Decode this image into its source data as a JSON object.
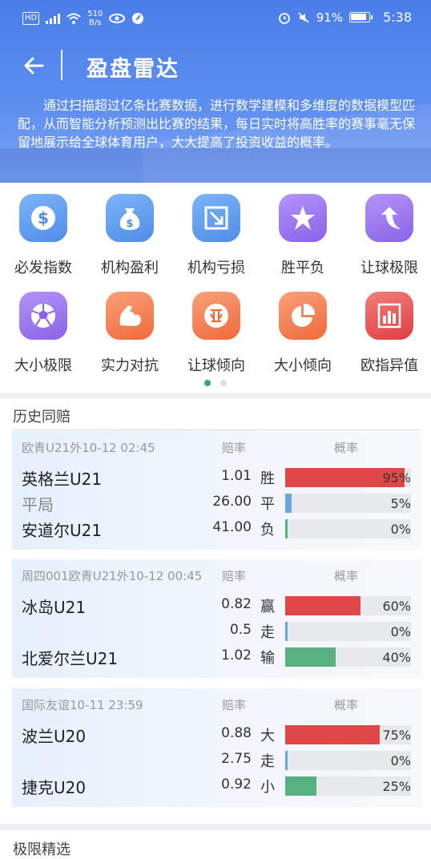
{
  "status": {
    "left_badge": "HD",
    "net_speed_value": "510",
    "net_speed_unit": "B/s",
    "battery": "91%",
    "time": "5:38"
  },
  "header": {
    "title": "盈盘雷达",
    "intro": "通过扫描超过亿条比赛数据，进行数学建模和多维度的数据模型匹配，从而智能分析预测出比赛的结果，每日实时将高胜率的赛事毫无保留地展示给全球体育用户，大大提高了投资收益的概率。"
  },
  "grid": {
    "items": [
      {
        "label": "必发指数",
        "icon": "dollar-coin-icon",
        "color": "#5f9ff3"
      },
      {
        "label": "机构盈利",
        "icon": "money-bag-icon",
        "color": "#5f9ff3"
      },
      {
        "label": "机构亏损",
        "icon": "down-arrow-box-icon",
        "color": "#5f9ff3"
      },
      {
        "label": "胜平负",
        "icon": "star-icon",
        "color": "#9a73ee"
      },
      {
        "label": "让球极限",
        "icon": "curved-arrow-icon",
        "color": "#9a73ee"
      },
      {
        "label": "大小极限",
        "icon": "soccer-ball-icon",
        "color": "#9a73ee"
      },
      {
        "label": "实力对抗",
        "icon": "flexed-arm-icon",
        "color": "#f47a4c"
      },
      {
        "label": "让球倾向",
        "icon": "ya-coin-icon",
        "color": "#f47a4c"
      },
      {
        "label": "大小倾向",
        "icon": "pie-chart-icon",
        "color": "#f47a4c"
      },
      {
        "label": "欧指异值",
        "icon": "bar-chart-icon",
        "color": "#e95050"
      }
    ]
  },
  "history": {
    "title": "历史同赔",
    "odds_header": "赔率",
    "prob_header": "概率",
    "matches": [
      {
        "header": "欧青U21外10-12 02:45",
        "rows": [
          {
            "team": "英格兰U21",
            "odds": "1.01",
            "result": "胜",
            "percent": "95%",
            "fraction": 0.95,
            "color": "#e04848"
          },
          {
            "team": "平局",
            "odds": "26.00",
            "result": "平",
            "percent": "5%",
            "fraction": 0.05,
            "color": "#6aa6e4"
          },
          {
            "team": "安道尔U21",
            "odds": "41.00",
            "result": "负",
            "percent": "0%",
            "fraction": 0.0,
            "color": "#56b07f"
          }
        ]
      },
      {
        "header": "周四001欧青U21外10-12 00:45",
        "rows": [
          {
            "team": "冰岛U21",
            "odds": "0.82",
            "result": "赢",
            "percent": "60%",
            "fraction": 0.6,
            "color": "#e04848"
          },
          {
            "team": "",
            "odds": "0.5",
            "result": "走",
            "percent": "0%",
            "fraction": 0.0,
            "color": "#6aa6e4"
          },
          {
            "team": "北爱尔兰U21",
            "odds": "1.02",
            "result": "输",
            "percent": "40%",
            "fraction": 0.4,
            "color": "#56b07f"
          }
        ]
      },
      {
        "header": "国际友谊10-11 23:59",
        "rows": [
          {
            "team": "波兰U20",
            "odds": "0.88",
            "result": "大",
            "percent": "75%",
            "fraction": 0.75,
            "color": "#e04848"
          },
          {
            "team": "",
            "odds": "2.75",
            "result": "走",
            "percent": "0%",
            "fraction": 0.0,
            "color": "#6aa6e4"
          },
          {
            "team": "捷克U20",
            "odds": "0.92",
            "result": "小",
            "percent": "25%",
            "fraction": 0.25,
            "color": "#56b07f"
          }
        ]
      }
    ]
  },
  "bottom": {
    "title": "极限精选"
  }
}
